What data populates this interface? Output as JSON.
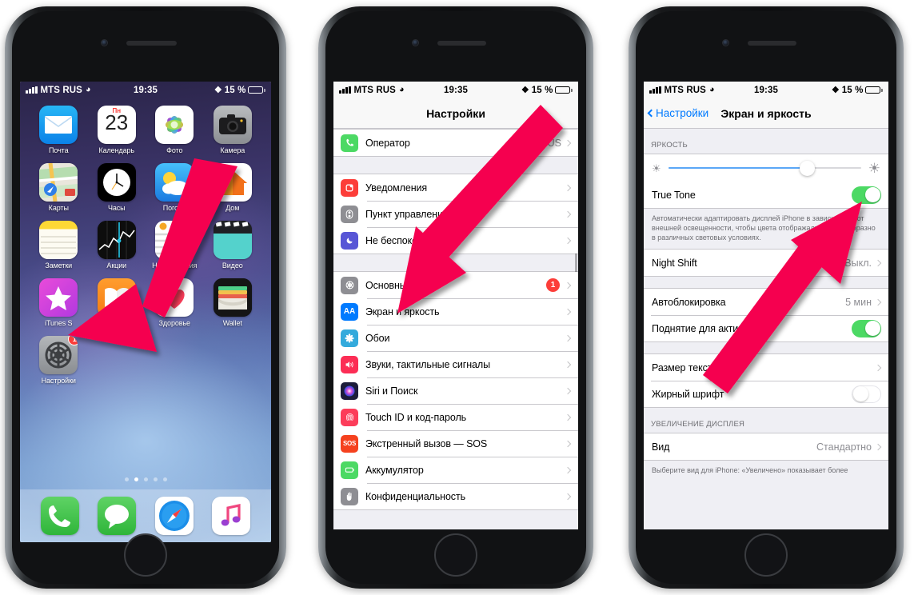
{
  "status_bar": {
    "carrier": "MTS RUS",
    "time": "19:35",
    "battery_percent": "15 %",
    "wifi_icon": "wifi-icon",
    "bluetooth_icon": "bluetooth-icon",
    "signal_icon": "signal-bars-icon"
  },
  "phone1": {
    "label": "home-screen",
    "apps": [
      {
        "name": "Почта",
        "icon": "mail-icon"
      },
      {
        "name": "Календарь",
        "icon": "calendar-icon",
        "dow": "Пн",
        "day": "23"
      },
      {
        "name": "Фото",
        "icon": "photos-icon"
      },
      {
        "name": "Камера",
        "icon": "camera-icon"
      },
      {
        "name": "Карты",
        "icon": "maps-icon"
      },
      {
        "name": "Часы",
        "icon": "clock-icon"
      },
      {
        "name": "Погода",
        "icon": "weather-icon"
      },
      {
        "name": "Дом",
        "icon": "home-app-icon"
      },
      {
        "name": "Заметки",
        "icon": "notes-icon"
      },
      {
        "name": "Акции",
        "icon": "stocks-icon"
      },
      {
        "name": "Напоминания",
        "icon": "reminders-icon"
      },
      {
        "name": "Видео",
        "icon": "videos-icon"
      },
      {
        "name": "iTunes S",
        "icon": "itunes-store-icon"
      },
      {
        "name": "iBooks",
        "icon": "ibooks-icon"
      },
      {
        "name": "Здоровье",
        "icon": "health-icon"
      },
      {
        "name": "Wallet",
        "icon": "wallet-icon"
      },
      {
        "name": "Настройки",
        "icon": "settings-icon",
        "badge": "1"
      }
    ],
    "page_dots": 5,
    "active_dot": 2,
    "dock": [
      {
        "name": "Телефон",
        "icon": "phone-icon"
      },
      {
        "name": "Сообщения",
        "icon": "messages-icon"
      },
      {
        "name": "Safari",
        "icon": "safari-icon"
      },
      {
        "name": "Музыка",
        "icon": "music-icon"
      }
    ]
  },
  "phone2": {
    "nav_title": "Настройки",
    "groups": [
      {
        "rows": [
          {
            "label": "Оператор",
            "value": "MTS RUS",
            "icon": "phone-green-icon",
            "chevron": true
          }
        ]
      },
      {
        "rows": [
          {
            "label": "Уведомления",
            "icon": "notifications-icon",
            "chevron": true
          },
          {
            "label": "Пункт управления",
            "icon": "control-center-icon",
            "chevron": true
          },
          {
            "label": "Не беспокоить",
            "icon": "do-not-disturb-icon",
            "chevron": true
          }
        ]
      },
      {
        "rows": [
          {
            "label": "Основные",
            "icon": "general-gear-icon",
            "badge": "1",
            "chevron": true
          },
          {
            "label": "Экран и яркость",
            "icon": "display-brightness-icon",
            "chevron": true
          },
          {
            "label": "Обои",
            "icon": "wallpaper-icon",
            "chevron": true
          },
          {
            "label": "Звуки, тактильные сигналы",
            "icon": "sounds-icon",
            "chevron": true
          },
          {
            "label": "Siri и Поиск",
            "icon": "siri-icon",
            "chevron": true
          },
          {
            "label": "Touch ID и код-пароль",
            "icon": "touch-id-icon",
            "chevron": true
          },
          {
            "label": "Экстренный вызов — SOS",
            "icon": "sos-icon",
            "chevron": true
          },
          {
            "label": "Аккумулятор",
            "icon": "battery-icon",
            "chevron": true
          },
          {
            "label": "Конфиденциальность",
            "icon": "privacy-hand-icon",
            "chevron": true
          }
        ]
      }
    ]
  },
  "phone3": {
    "back_label": "Настройки",
    "nav_title": "Экран и яркость",
    "brightness_header": "ЯРКОСТЬ",
    "brightness_value": 72,
    "true_tone": {
      "label": "True Tone",
      "on": true
    },
    "true_tone_footer": "Автоматически адаптировать дисплей iPhone в зависимости от внешней освещенности, чтобы цвета отображались единообразно в различных световых условиях.",
    "night_shift": {
      "label": "Night Shift",
      "value": "Выкл."
    },
    "auto_lock": {
      "label": "Автоблокировка",
      "value": "5 мин"
    },
    "raise_to_wake": {
      "label": "Поднятие для активации",
      "on": true
    },
    "text_size": {
      "label": "Размер текста"
    },
    "bold_text": {
      "label": "Жирный шрифт",
      "on": false
    },
    "zoom_header": "УВЕЛИЧЕНИЕ ДИСПЛЕЯ",
    "view": {
      "label": "Вид",
      "value": "Стандартно"
    },
    "zoom_footer": "Выберите вид для iPhone: «Увеличено» показывает более"
  },
  "annotations": {
    "arrow_color": "#f5054f",
    "arrows": [
      {
        "name": "arrow-to-settings-app"
      },
      {
        "name": "arrow-to-display-brightness-row"
      },
      {
        "name": "arrow-to-true-tone-toggle"
      }
    ]
  }
}
